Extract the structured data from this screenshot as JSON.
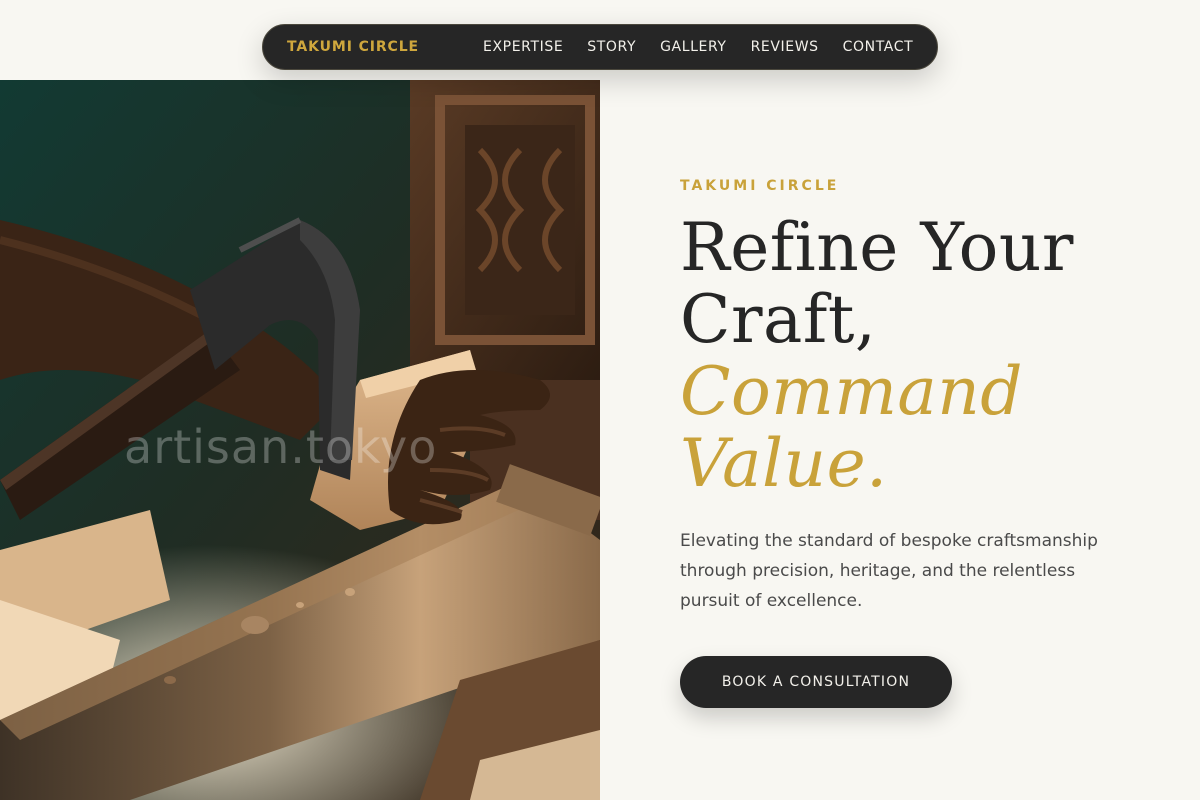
{
  "nav": {
    "brand": "TAKUMI CIRCLE",
    "links": [
      {
        "label": "EXPERTISE"
      },
      {
        "label": "STORY"
      },
      {
        "label": "GALLERY"
      },
      {
        "label": "REVIEWS"
      },
      {
        "label": "CONTACT"
      }
    ]
  },
  "hero": {
    "image_watermark": "artisan.tokyo",
    "eyebrow": "TAKUMI CIRCLE",
    "headline_line1": "Refine Your",
    "headline_line2": "Craft,",
    "headline_accent_line1": "Command",
    "headline_accent_line2": "Value.",
    "subcopy": "Elevating the standard of bespoke craftsmanship through precision, heritage, and the relentless pursuit of excellence.",
    "cta_label": "BOOK A CONSULTATION"
  },
  "colors": {
    "background": "#f8f7f2",
    "dark": "#262626",
    "accent_gold": "#c9a23a",
    "body_text": "#4a4a4a"
  }
}
